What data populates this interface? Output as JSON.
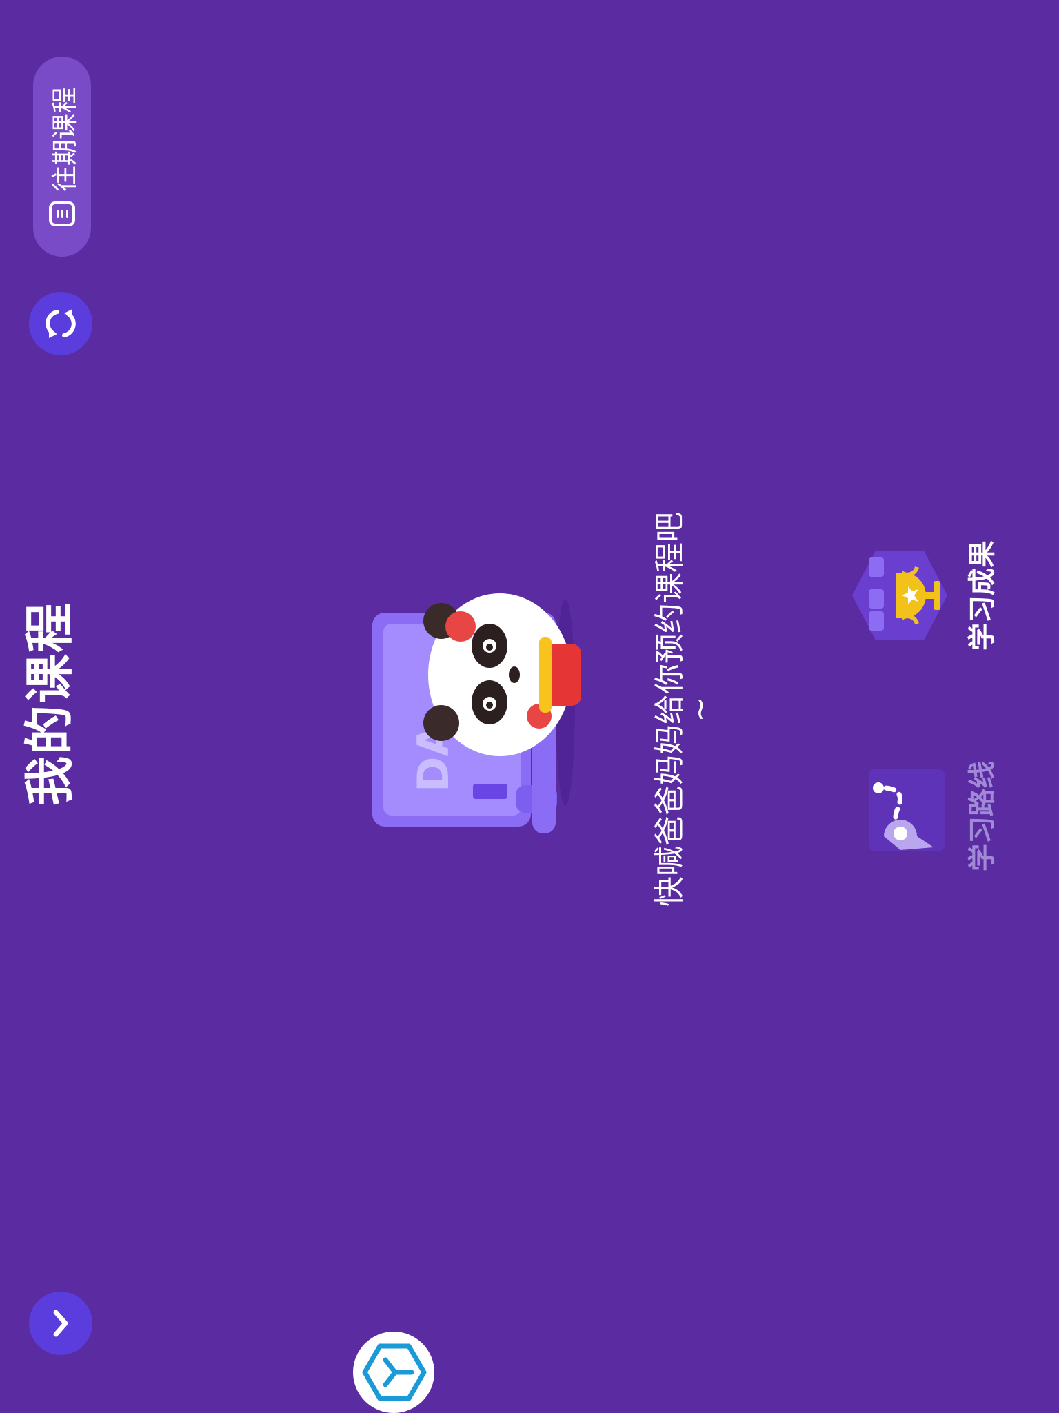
{
  "header": {
    "title": "我的课程",
    "past_courses_label": "往期课程"
  },
  "icons": {
    "past_courses": "list-icon",
    "refresh": "refresh-icon",
    "collapse": "chevron-down-icon",
    "hex": "hexagon-logo-icon",
    "illustration": "panda-presenter-illustration"
  },
  "main": {
    "board_letters": "DA",
    "empty_message": "快喊爸爸妈妈给你预约课程吧~"
  },
  "nav": {
    "results_label": "学习成果",
    "route_label": "学习路线"
  },
  "colors": {
    "background": "#5b2ca1",
    "button": "#5a3ddc",
    "pill": "#7a4bc6",
    "trophy": "#f2c21b",
    "muted_label": "#a08ad8"
  }
}
